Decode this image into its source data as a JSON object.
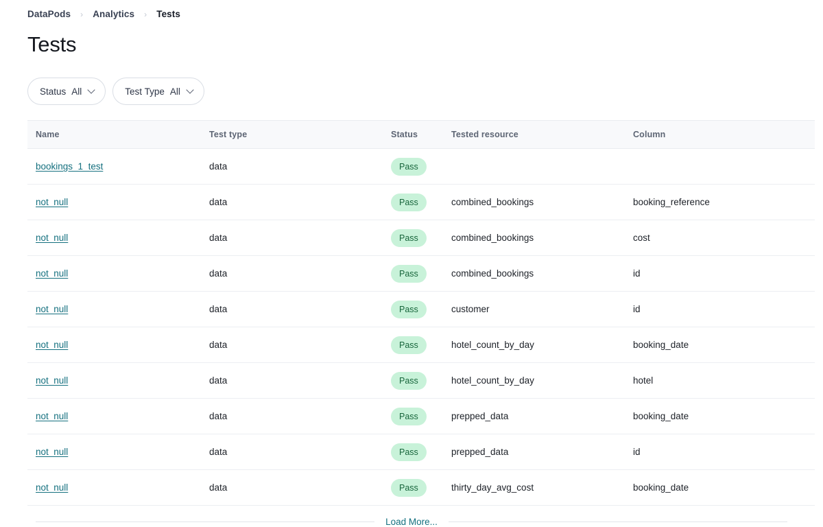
{
  "breadcrumb": {
    "separator": "›",
    "items": [
      {
        "label": "DataPods",
        "current": false
      },
      {
        "label": "Analytics",
        "current": false
      },
      {
        "label": "Tests",
        "current": true
      }
    ]
  },
  "page": {
    "title": "Tests"
  },
  "filters": [
    {
      "label": "Status",
      "value": "All",
      "icon": "chevron-down-icon"
    },
    {
      "label": "Test Type",
      "value": "All",
      "icon": "chevron-down-icon"
    }
  ],
  "table": {
    "columns": [
      "Name",
      "Test type",
      "Status",
      "Tested resource",
      "Column"
    ],
    "rows": [
      {
        "name": "bookings_1_test",
        "test_type": "data",
        "status": "Pass",
        "tested_resource": "",
        "column": ""
      },
      {
        "name": "not_null",
        "test_type": "data",
        "status": "Pass",
        "tested_resource": "combined_bookings",
        "column": "booking_reference"
      },
      {
        "name": "not_null",
        "test_type": "data",
        "status": "Pass",
        "tested_resource": "combined_bookings",
        "column": "cost"
      },
      {
        "name": "not_null",
        "test_type": "data",
        "status": "Pass",
        "tested_resource": "combined_bookings",
        "column": "id"
      },
      {
        "name": "not_null",
        "test_type": "data",
        "status": "Pass",
        "tested_resource": "customer",
        "column": "id"
      },
      {
        "name": "not_null",
        "test_type": "data",
        "status": "Pass",
        "tested_resource": "hotel_count_by_day",
        "column": "booking_date"
      },
      {
        "name": "not_null",
        "test_type": "data",
        "status": "Pass",
        "tested_resource": "hotel_count_by_day",
        "column": "hotel"
      },
      {
        "name": "not_null",
        "test_type": "data",
        "status": "Pass",
        "tested_resource": "prepped_data",
        "column": "booking_date"
      },
      {
        "name": "not_null",
        "test_type": "data",
        "status": "Pass",
        "tested_resource": "prepped_data",
        "column": "id"
      },
      {
        "name": "not_null",
        "test_type": "data",
        "status": "Pass",
        "tested_resource": "thirty_day_avg_cost",
        "column": "booking_date"
      }
    ]
  },
  "footer": {
    "load_more_label": "Load More..."
  },
  "colors": {
    "link": "#136f7e",
    "badge_pass_bg": "#c8f2d9",
    "badge_pass_text": "#17653b",
    "header_bg": "#f8f9fb",
    "border": "#eceef2"
  }
}
